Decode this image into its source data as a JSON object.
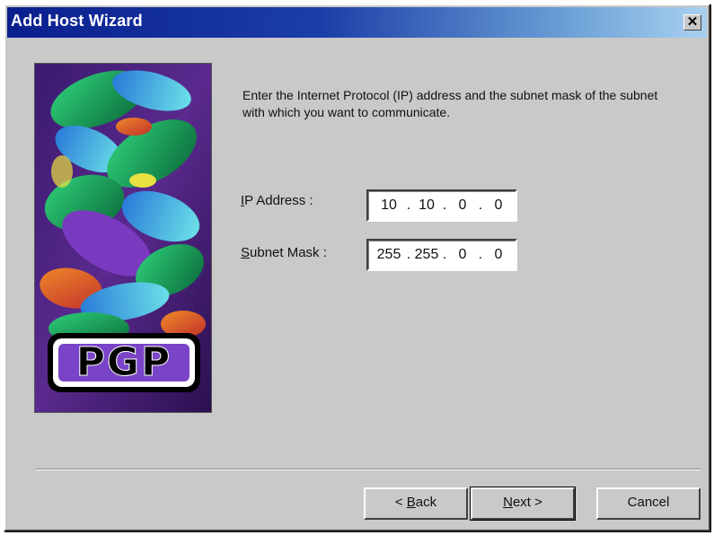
{
  "window": {
    "title": "Add Host Wizard",
    "close_glyph": "✕"
  },
  "logo": {
    "text": "PGP",
    "icon": "pgp-logo"
  },
  "description": "Enter the Internet Protocol (IP) address and the subnet mask of the subnet with which you want to communicate.",
  "ip_address": {
    "label_mnemonic": "I",
    "label_rest": "P Address :",
    "octets": [
      "10",
      "10",
      "0",
      "0"
    ]
  },
  "subnet_mask": {
    "label_mnemonic": "S",
    "label_rest": "ubnet Mask :",
    "octets": [
      "255",
      "255",
      "0",
      "0"
    ]
  },
  "buttons": {
    "back_prefix": "< ",
    "back_mnemonic": "B",
    "back_rest": "ack",
    "next_mnemonic": "N",
    "next_rest": "ext >",
    "cancel": "Cancel"
  },
  "colors": {
    "dialog_bg": "#c9c9c9",
    "title_start": "#0a1f8e",
    "title_end": "#a9d0f0"
  }
}
